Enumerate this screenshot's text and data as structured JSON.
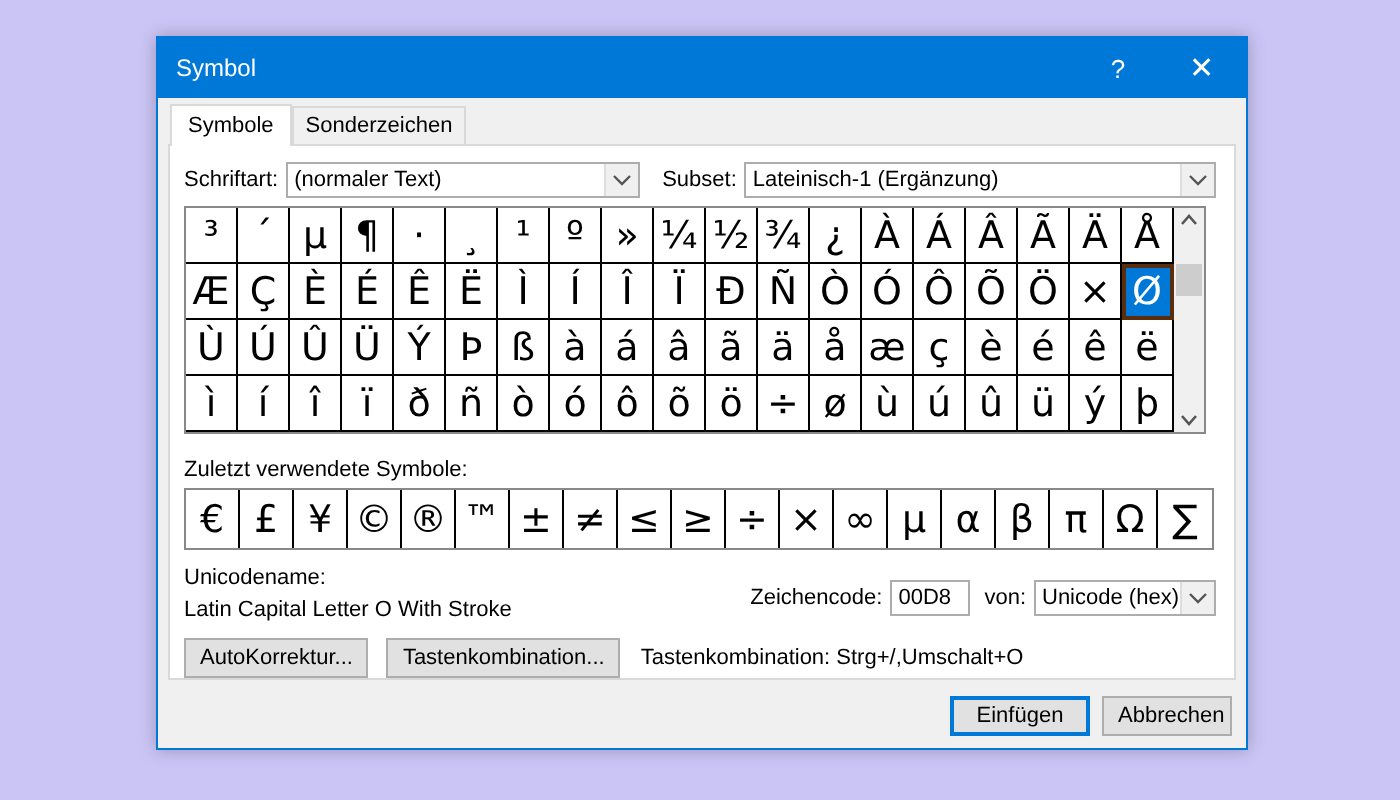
{
  "window": {
    "title": "Symbol",
    "help": "?",
    "close": "✕"
  },
  "tabs": [
    {
      "label": "Symbole",
      "selected": true
    },
    {
      "label": "Sonderzeichen",
      "selected": false
    }
  ],
  "font": {
    "label": "Schriftart:",
    "value": "(normaler Text)"
  },
  "subset": {
    "label": "Subset:",
    "value": "Lateinisch-1 (Ergänzung)"
  },
  "grid": [
    [
      {
        "char": "³",
        "selected": false
      },
      {
        "char": "´",
        "selected": false
      },
      {
        "char": "µ",
        "selected": false
      },
      {
        "char": "¶",
        "selected": false
      },
      {
        "char": "·",
        "selected": false
      },
      {
        "char": "¸",
        "selected": false
      },
      {
        "char": "¹",
        "selected": false
      },
      {
        "char": "º",
        "selected": false
      },
      {
        "char": "»",
        "selected": false
      },
      {
        "char": "¼",
        "selected": false
      },
      {
        "char": "½",
        "selected": false
      },
      {
        "char": "¾",
        "selected": false
      },
      {
        "char": "¿",
        "selected": false
      },
      {
        "char": "À",
        "selected": false
      },
      {
        "char": "Á",
        "selected": false
      },
      {
        "char": "Â",
        "selected": false
      },
      {
        "char": "Ã",
        "selected": false
      },
      {
        "char": "Ä",
        "selected": false
      },
      {
        "char": "Å",
        "selected": false
      }
    ],
    [
      {
        "char": "Æ",
        "selected": false
      },
      {
        "char": "Ç",
        "selected": false
      },
      {
        "char": "È",
        "selected": false
      },
      {
        "char": "É",
        "selected": false
      },
      {
        "char": "Ê",
        "selected": false
      },
      {
        "char": "Ë",
        "selected": false
      },
      {
        "char": "Ì",
        "selected": false
      },
      {
        "char": "Í",
        "selected": false
      },
      {
        "char": "Î",
        "selected": false
      },
      {
        "char": "Ï",
        "selected": false
      },
      {
        "char": "Ð",
        "selected": false
      },
      {
        "char": "Ñ",
        "selected": false
      },
      {
        "char": "Ò",
        "selected": false
      },
      {
        "char": "Ó",
        "selected": false
      },
      {
        "char": "Ô",
        "selected": false
      },
      {
        "char": "Õ",
        "selected": false
      },
      {
        "char": "Ö",
        "selected": false
      },
      {
        "char": "×",
        "selected": false
      },
      {
        "char": "Ø",
        "selected": true
      }
    ],
    [
      {
        "char": "Ù",
        "selected": false
      },
      {
        "char": "Ú",
        "selected": false
      },
      {
        "char": "Û",
        "selected": false
      },
      {
        "char": "Ü",
        "selected": false
      },
      {
        "char": "Ý",
        "selected": false
      },
      {
        "char": "Þ",
        "selected": false
      },
      {
        "char": "ß",
        "selected": false
      },
      {
        "char": "à",
        "selected": false
      },
      {
        "char": "á",
        "selected": false
      },
      {
        "char": "â",
        "selected": false
      },
      {
        "char": "ã",
        "selected": false
      },
      {
        "char": "ä",
        "selected": false
      },
      {
        "char": "å",
        "selected": false
      },
      {
        "char": "æ",
        "selected": false
      },
      {
        "char": "ç",
        "selected": false
      },
      {
        "char": "è",
        "selected": false
      },
      {
        "char": "é",
        "selected": false
      },
      {
        "char": "ê",
        "selected": false
      },
      {
        "char": "ë",
        "selected": false
      }
    ],
    [
      {
        "char": "ì",
        "selected": false
      },
      {
        "char": "í",
        "selected": false
      },
      {
        "char": "î",
        "selected": false
      },
      {
        "char": "ï",
        "selected": false
      },
      {
        "char": "ð",
        "selected": false
      },
      {
        "char": "ñ",
        "selected": false
      },
      {
        "char": "ò",
        "selected": false
      },
      {
        "char": "ó",
        "selected": false
      },
      {
        "char": "ô",
        "selected": false
      },
      {
        "char": "õ",
        "selected": false
      },
      {
        "char": "ö",
        "selected": false
      },
      {
        "char": "÷",
        "selected": false
      },
      {
        "char": "ø",
        "selected": false
      },
      {
        "char": "ù",
        "selected": false
      },
      {
        "char": "ú",
        "selected": false
      },
      {
        "char": "û",
        "selected": false
      },
      {
        "char": "ü",
        "selected": false
      },
      {
        "char": "ý",
        "selected": false
      },
      {
        "char": "þ",
        "selected": false
      }
    ]
  ],
  "recent": {
    "label": "Zuletzt verwendete Symbole:",
    "symbols": [
      "€",
      "£",
      "¥",
      "©",
      "®",
      "™",
      "±",
      "≠",
      "≤",
      "≥",
      "÷",
      "×",
      "∞",
      "µ",
      "α",
      "β",
      "π",
      "Ω",
      "∑"
    ]
  },
  "unicode_name": {
    "label": "Unicodename:",
    "value": "Latin Capital Letter O With Stroke"
  },
  "char_code": {
    "label": "Zeichencode:",
    "value": "00D8"
  },
  "from": {
    "label": "von:",
    "value": "Unicode (hex)"
  },
  "buttons": [
    {
      "label": "AutoKorrektur..."
    },
    {
      "label": "Tastenkombination..."
    }
  ],
  "shortcut": "Tastenkombination: Strg+/,Umschalt+O",
  "footer": [
    {
      "label": "Einfügen",
      "selected": true
    },
    {
      "label": "Abbrechen",
      "selected": false
    }
  ]
}
